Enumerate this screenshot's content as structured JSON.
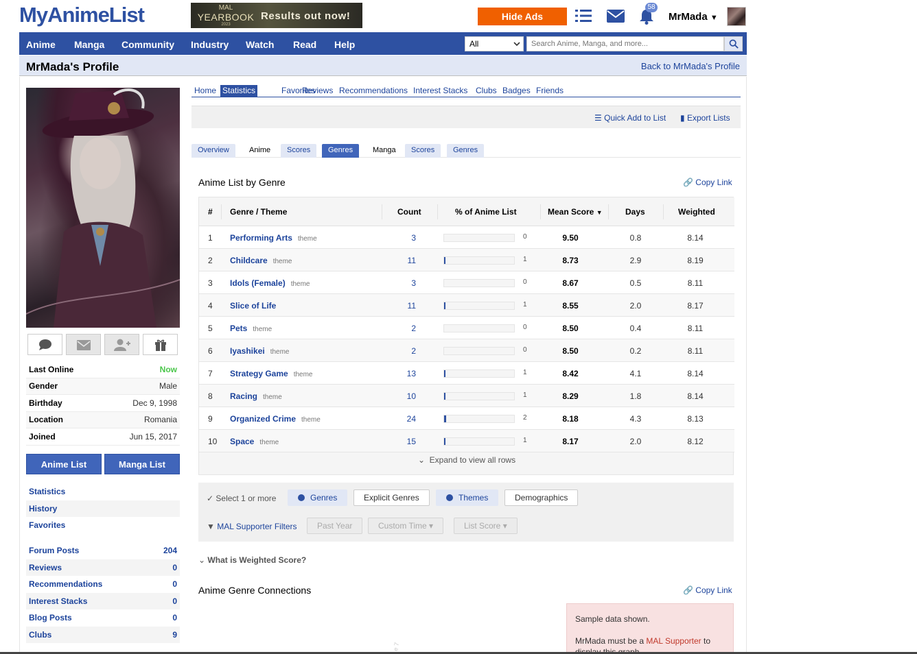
{
  "header": {
    "logo": "MyAnimeList",
    "yearbook": {
      "line1": "MAL",
      "line2": "YEARBOOK",
      "line3": "2023",
      "message": "Results out now!"
    },
    "hide_ads": "Hide Ads",
    "notification_count": "58",
    "username": "MrMada"
  },
  "nav": {
    "items": [
      "Anime",
      "Manga",
      "Community",
      "Industry",
      "Watch",
      "Read",
      "Help"
    ],
    "search_category": "All",
    "search_placeholder": "Search Anime, Manga, and more..."
  },
  "title_bar": {
    "title": "MrMada's Profile",
    "back_link": "Back to MrMada's Profile"
  },
  "profile": {
    "info": [
      {
        "key": "Last Online",
        "value": "Now"
      },
      {
        "key": "Gender",
        "value": "Male"
      },
      {
        "key": "Birthday",
        "value": "Dec 9, 1998"
      },
      {
        "key": "Location",
        "value": "Romania"
      },
      {
        "key": "Joined",
        "value": "Jun 15, 2017"
      }
    ],
    "anime_list": "Anime List",
    "manga_list": "Manga List",
    "links": [
      "Statistics",
      "History",
      "Favorites"
    ],
    "stats": [
      {
        "key": "Forum Posts",
        "value": "204"
      },
      {
        "key": "Reviews",
        "value": "0"
      },
      {
        "key": "Recommendations",
        "value": "0"
      },
      {
        "key": "Interest Stacks",
        "value": "0"
      },
      {
        "key": "Blog Posts",
        "value": "0"
      },
      {
        "key": "Clubs",
        "value": "9"
      }
    ]
  },
  "tabs": [
    "Home",
    "Statistics",
    "Favorites",
    "Reviews",
    "Recommendations",
    "Interest Stacks",
    "Clubs",
    "Badges",
    "Friends"
  ],
  "toolbar": {
    "quick_add": "Quick Add to List",
    "export": "Export Lists"
  },
  "subtabs": [
    "Overview",
    "Anime",
    "Scores",
    "Genres",
    "Manga",
    "Scores",
    "Genres"
  ],
  "genre_section": {
    "title": "Anime List by Genre",
    "copy_link": "Copy Link",
    "columns": [
      "#",
      "Genre / Theme",
      "Count",
      "% of Anime List",
      "Mean Score",
      "Days",
      "Weighted"
    ],
    "rows": [
      {
        "rank": "1",
        "name": "Performing Arts",
        "tag": "theme",
        "count": "3",
        "pct": "0",
        "bar": 0,
        "mean": "9.50",
        "days": "0.8",
        "weighted": "8.14"
      },
      {
        "rank": "2",
        "name": "Childcare",
        "tag": "theme",
        "count": "11",
        "pct": "1",
        "bar": 1,
        "mean": "8.73",
        "days": "2.9",
        "weighted": "8.19"
      },
      {
        "rank": "3",
        "name": "Idols (Female)",
        "tag": "theme",
        "count": "3",
        "pct": "0",
        "bar": 0,
        "mean": "8.67",
        "days": "0.5",
        "weighted": "8.11"
      },
      {
        "rank": "4",
        "name": "Slice of Life",
        "tag": "",
        "count": "11",
        "pct": "1",
        "bar": 1,
        "mean": "8.55",
        "days": "2.0",
        "weighted": "8.17"
      },
      {
        "rank": "5",
        "name": "Pets",
        "tag": "theme",
        "count": "2",
        "pct": "0",
        "bar": 0,
        "mean": "8.50",
        "days": "0.4",
        "weighted": "8.11"
      },
      {
        "rank": "6",
        "name": "Iyashikei",
        "tag": "theme",
        "count": "2",
        "pct": "0",
        "bar": 0,
        "mean": "8.50",
        "days": "0.2",
        "weighted": "8.11"
      },
      {
        "rank": "7",
        "name": "Strategy Game",
        "tag": "theme",
        "count": "13",
        "pct": "1",
        "bar": 1,
        "mean": "8.42",
        "days": "4.1",
        "weighted": "8.14"
      },
      {
        "rank": "8",
        "name": "Racing",
        "tag": "theme",
        "count": "10",
        "pct": "1",
        "bar": 1,
        "mean": "8.29",
        "days": "1.8",
        "weighted": "8.14"
      },
      {
        "rank": "9",
        "name": "Organized Crime",
        "tag": "theme",
        "count": "24",
        "pct": "2",
        "bar": 2,
        "mean": "8.18",
        "days": "4.3",
        "weighted": "8.13"
      },
      {
        "rank": "10",
        "name": "Space",
        "tag": "theme",
        "count": "15",
        "pct": "1",
        "bar": 1,
        "mean": "8.17",
        "days": "2.0",
        "weighted": "8.12"
      }
    ],
    "expand": "Expand to view all rows"
  },
  "filters": {
    "select_label": "Select 1 or more",
    "chips": [
      "Genres",
      "Explicit Genres",
      "Themes",
      "Demographics"
    ],
    "supporter_label": "MAL Supporter Filters",
    "supporter_chips": [
      "Past Year",
      "Custom Time",
      "List Score"
    ]
  },
  "weighted_question": "What is Weighted Score?",
  "connections": {
    "title": "Anime Genre Connections",
    "copy_link": "Copy Link",
    "sample_line1": "Sample data shown.",
    "sample_line2_pre": "MrMada must be a",
    "sample_link": "MAL Supporter",
    "sample_line2_post": "to",
    "sample_line3": "display this graph."
  },
  "colors": {
    "brand": "#2e51a2",
    "hide_ads": "#f06000",
    "online": "#4ac64a"
  }
}
